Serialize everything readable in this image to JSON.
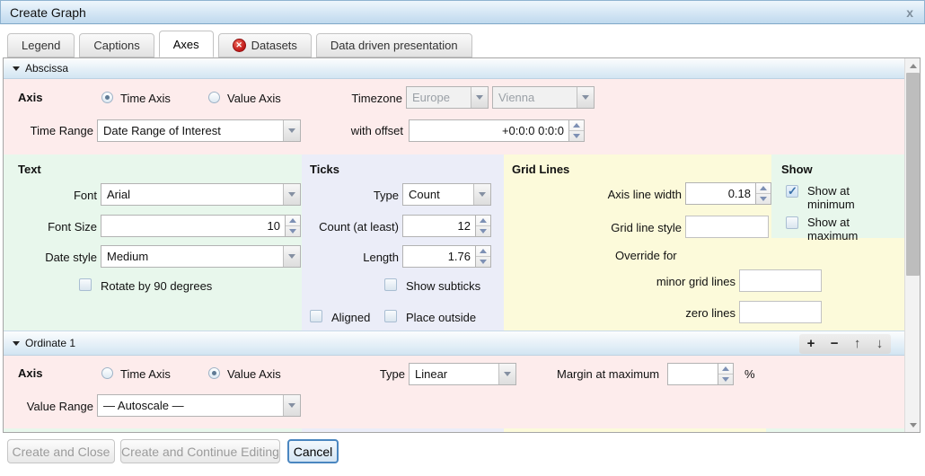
{
  "titlebar": {
    "title": "Create Graph",
    "close": "x"
  },
  "tabs": {
    "legend": "Legend",
    "captions": "Captions",
    "axes": "Axes",
    "datasets": "Datasets",
    "datasets_error_glyph": "✕",
    "data_driven": "Data driven presentation"
  },
  "abscissa": {
    "title": "Abscissa",
    "axis": "Axis",
    "time_axis": "Time Axis",
    "value_axis": "Value Axis",
    "timezone": "Timezone",
    "timezone_region": "Europe",
    "timezone_city": "Vienna",
    "time_range": "Time Range",
    "time_range_value": "Date Range of Interest",
    "offset": "with offset",
    "offset_value": "+0:0:0 0:0:0"
  },
  "text_section": {
    "title": "Text",
    "font": "Font",
    "font_value": "Arial",
    "font_size": "Font Size",
    "font_size_value": "10",
    "date_style": "Date style",
    "date_style_value": "Medium",
    "rotate": "Rotate by 90 degrees"
  },
  "ticks_section": {
    "title": "Ticks",
    "type": "Type",
    "type_value": "Count",
    "count": "Count (at least)",
    "count_value": "12",
    "length": "Length",
    "length_value": "1.76",
    "show_subticks": "Show subticks",
    "aligned": "Aligned",
    "place_outside": "Place outside"
  },
  "grid_section": {
    "title": "Grid Lines",
    "axis_line_width": "Axis line width",
    "axis_line_width_value": "0.18",
    "grid_line_style": "Grid line style",
    "override": "Override for",
    "minor": "minor grid lines",
    "zero": "zero lines"
  },
  "show_section": {
    "title": "Show",
    "at_minimum": "Show at minimum",
    "at_maximum": "Show at maximum"
  },
  "ordinate": {
    "title": "Ordinate 1",
    "add": "+",
    "remove": "−",
    "move_up": "↑",
    "move_down": "↓",
    "axis": "Axis",
    "time_axis": "Time Axis",
    "value_axis": "Value Axis",
    "type": "Type",
    "type_value": "Linear",
    "margin": "Margin at maximum",
    "margin_unit": "%",
    "value_range": "Value Range",
    "value_range_value": "— Autoscale —"
  },
  "footer": {
    "create_close": "Create and Close",
    "create_continue": "Create and Continue Editing",
    "cancel": "Cancel"
  }
}
